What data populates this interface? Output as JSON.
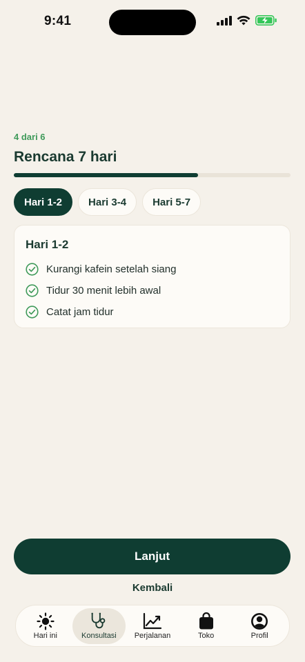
{
  "status_bar": {
    "time": "9:41"
  },
  "plan": {
    "step_label": "4 dari 6",
    "title": "Rencana 7 hari",
    "progress": 0.667
  },
  "tabs": [
    {
      "label": "Hari 1-2",
      "active": true
    },
    {
      "label": "Hari 3-4",
      "active": false
    },
    {
      "label": "Hari 5-7",
      "active": false
    }
  ],
  "card": {
    "title": "Hari 1-2",
    "items": [
      {
        "text": "Kurangi kafein setelah siang",
        "icon": "check-circle-icon"
      },
      {
        "text": "Tidur 30 menit lebih awal",
        "icon": "check-circle-icon"
      },
      {
        "text": "Catat jam tidur",
        "icon": "check-circle-icon"
      }
    ]
  },
  "actions": {
    "primary_label": "Lanjut",
    "secondary_label": "Kembali"
  },
  "nav": {
    "items": [
      {
        "label": "Hari ini",
        "icon": "sun-icon",
        "active": false
      },
      {
        "label": "Konsultasi",
        "icon": "stethoscope-icon",
        "active": true
      },
      {
        "label": "Perjalanan",
        "icon": "trend-chart-icon",
        "active": false
      },
      {
        "label": "Toko",
        "icon": "shopping-bag-icon",
        "active": false
      },
      {
        "label": "Profil",
        "icon": "profile-icon",
        "active": false
      }
    ]
  },
  "colors": {
    "background": "#f5f1ea",
    "primary": "#0f3d32",
    "accent_green": "#3f9a5a",
    "battery": "#34c759"
  }
}
